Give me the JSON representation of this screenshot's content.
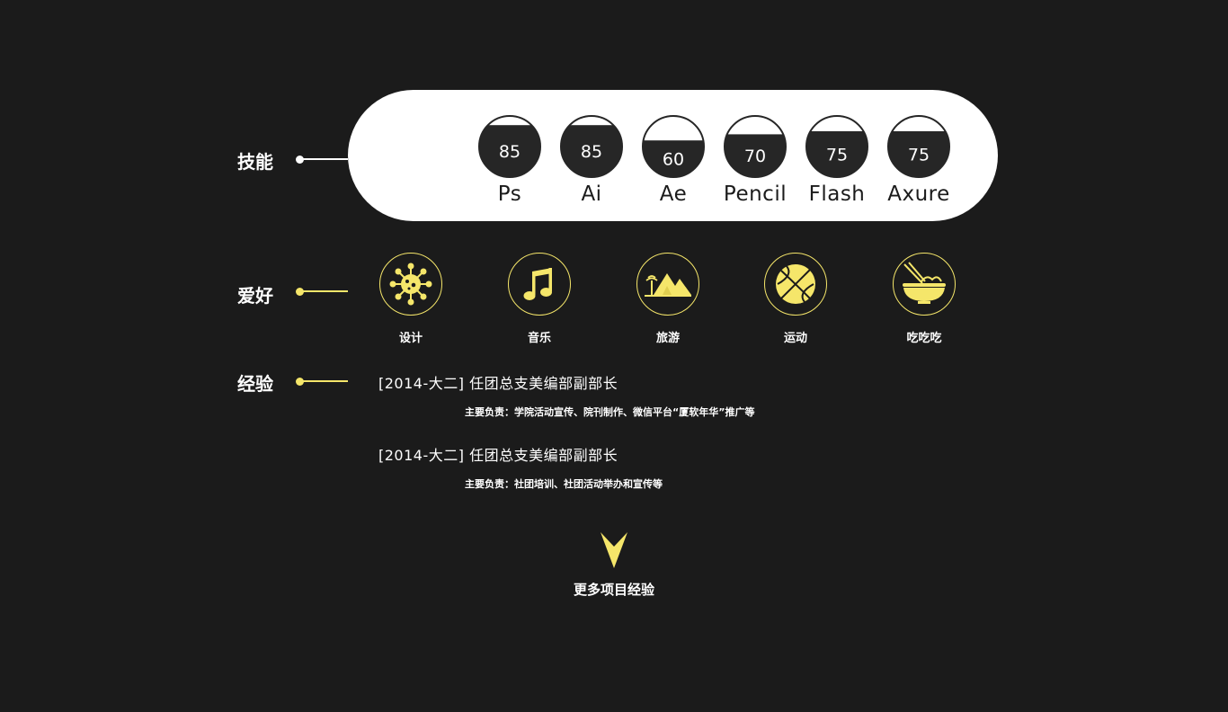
{
  "sections": {
    "skills": "技能",
    "hobbies": "爱好",
    "experience": "经验"
  },
  "skills": [
    {
      "name": "Ps",
      "value": 85
    },
    {
      "name": "Ai",
      "value": 85
    },
    {
      "name": "Ae",
      "value": 60
    },
    {
      "name": "Pencil",
      "value": 70
    },
    {
      "name": "Flash",
      "value": 75
    },
    {
      "name": "Axure",
      "value": 75
    }
  ],
  "hobbies": [
    {
      "label": "设计",
      "icon": "virus-design-icon"
    },
    {
      "label": "音乐",
      "icon": "music-note-icon"
    },
    {
      "label": "旅游",
      "icon": "mountain-travel-icon"
    },
    {
      "label": "运动",
      "icon": "basketball-icon"
    },
    {
      "label": "吃吃吃",
      "icon": "noodle-bowl-icon"
    }
  ],
  "experience": [
    {
      "title": "[2014-大二] 任团总支美编部副部长",
      "desc": "主要负责：学院活动宣传、院刊制作、微信平台“厦软年华”推广等"
    },
    {
      "title": "[2014-大二] 任团总支美编部副部长",
      "desc": "主要负责：社团培训、社团活动举办和宣传等"
    }
  ],
  "more": {
    "label": "更多项目经验",
    "icon": "arrow-down-icon"
  },
  "colors": {
    "background": "#1b1b1b",
    "accent": "#f5e66a",
    "panel": "#ffffff",
    "dark": "#262626"
  }
}
